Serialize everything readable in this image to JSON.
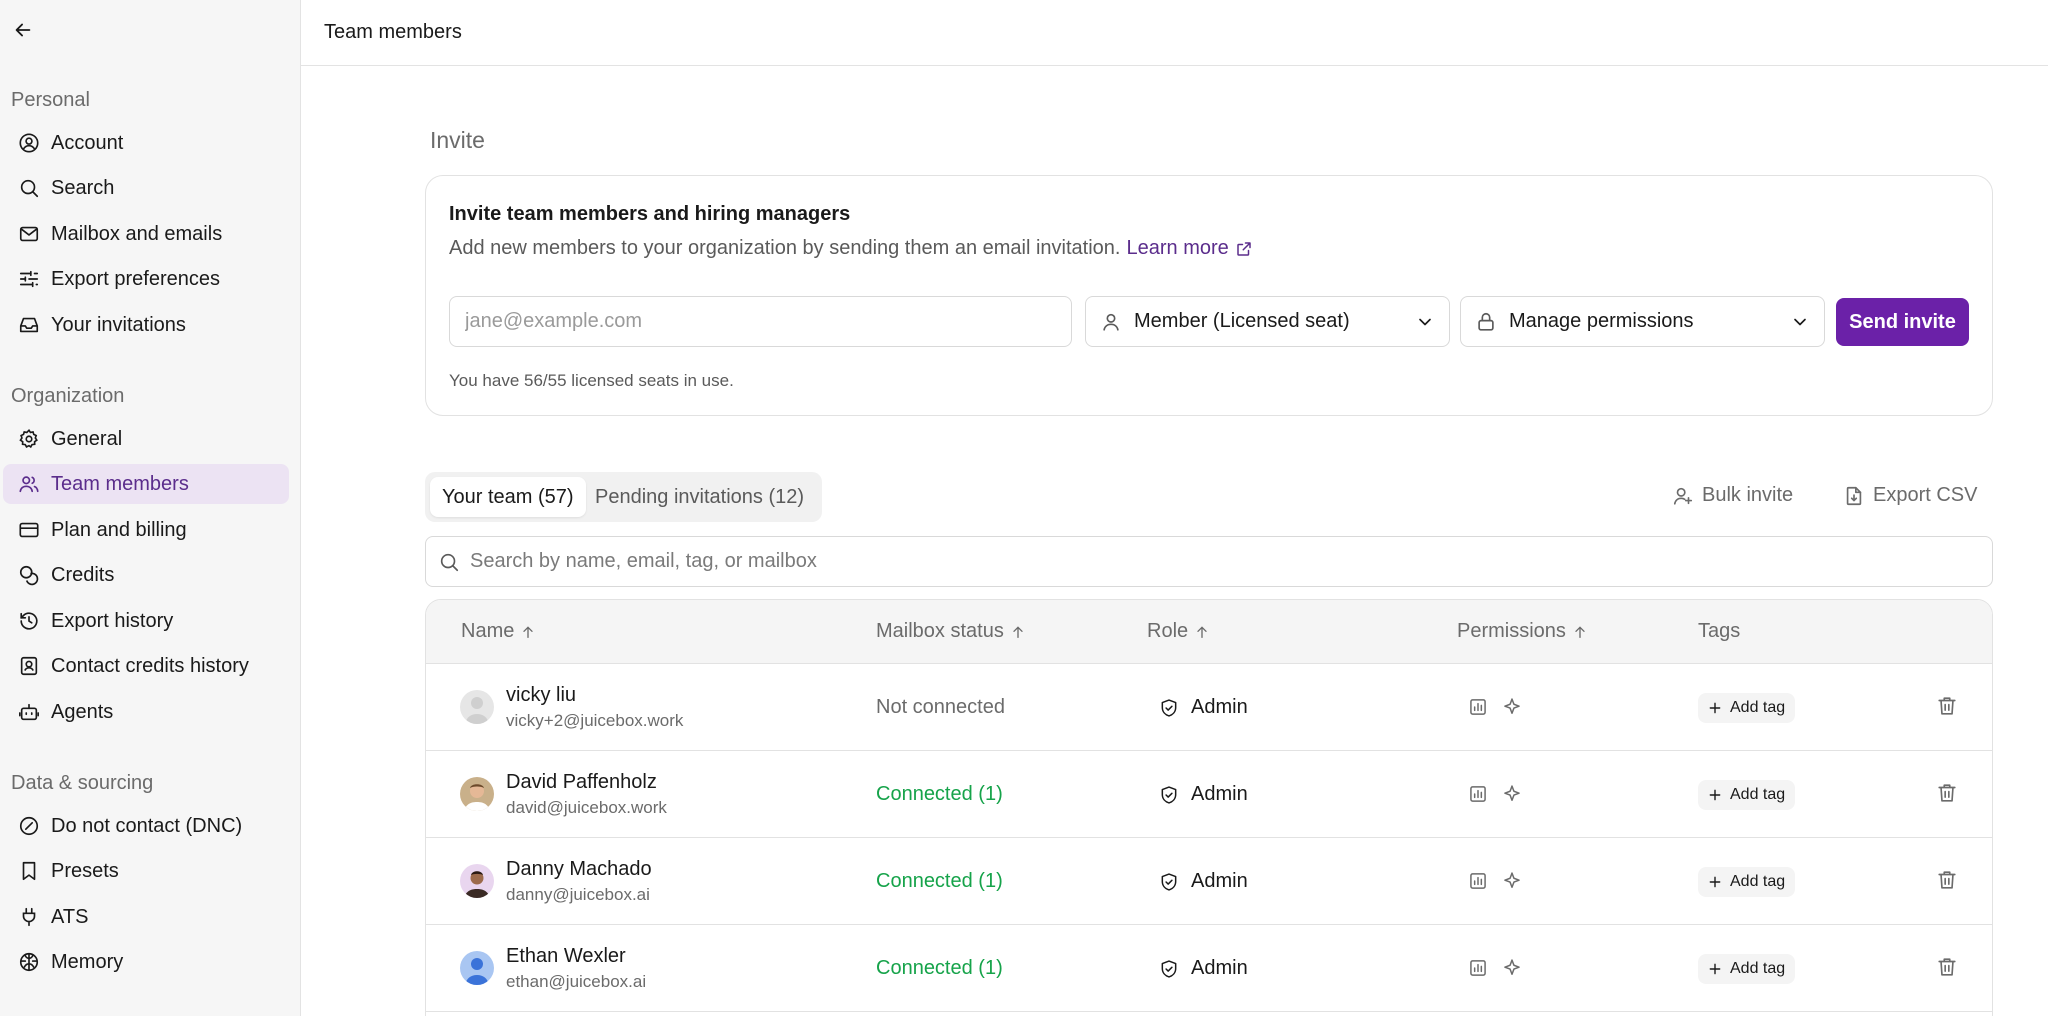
{
  "header": {
    "title": "Team members"
  },
  "sidebar": {
    "sections": [
      {
        "label": "Personal",
        "items": [
          {
            "label": "Account",
            "icon": "user-circle-icon"
          },
          {
            "label": "Search",
            "icon": "search-icon"
          },
          {
            "label": "Mailbox and emails",
            "icon": "mail-icon"
          },
          {
            "label": "Export preferences",
            "icon": "sliders-icon"
          },
          {
            "label": "Your invitations",
            "icon": "inbox-icon"
          }
        ]
      },
      {
        "label": "Organization",
        "items": [
          {
            "label": "General",
            "icon": "gear-icon"
          },
          {
            "label": "Team members",
            "icon": "users-icon",
            "active": true
          },
          {
            "label": "Plan and billing",
            "icon": "credit-card-icon"
          },
          {
            "label": "Credits",
            "icon": "coins-icon"
          },
          {
            "label": "Export history",
            "icon": "history-icon"
          },
          {
            "label": "Contact credits history",
            "icon": "contact-book-icon"
          },
          {
            "label": "Agents",
            "icon": "robot-icon"
          }
        ]
      },
      {
        "label": "Data & sourcing",
        "items": [
          {
            "label": "Do not contact (DNC)",
            "icon": "block-icon"
          },
          {
            "label": "Presets",
            "icon": "bookmark-icon"
          },
          {
            "label": "ATS",
            "icon": "plug-icon"
          },
          {
            "label": "Memory",
            "icon": "brain-icon"
          }
        ]
      }
    ]
  },
  "invite": {
    "heading": "Invite",
    "card_title": "Invite team members and hiring managers",
    "description": "Add new members to your organization by sending them an email invitation.",
    "learn_more": "Learn more",
    "email_placeholder": "jane@example.com",
    "email_value": "",
    "role_select": "Member (Licensed seat)",
    "permissions_select": "Manage permissions",
    "send_label": "Send invite",
    "seats_text": "You have 56/55 licensed seats in use."
  },
  "tabs": {
    "your_team": "Your team (57)",
    "pending": "Pending invitations (12)"
  },
  "actions": {
    "bulk_invite": "Bulk invite",
    "export_csv": "Export CSV"
  },
  "search": {
    "placeholder": "Search by name, email, tag, or mailbox"
  },
  "table": {
    "columns": {
      "name": "Name",
      "mailbox": "Mailbox status",
      "role": "Role",
      "permissions": "Permissions",
      "tags": "Tags"
    },
    "add_tag_label": "Add tag",
    "status_colors": {
      "connected": "#16a34a",
      "not_connected": "#6b6b6b"
    },
    "rows": [
      {
        "name": "vicky liu",
        "email": "vicky+2@juicebox.work",
        "mailbox": "Not connected",
        "connected": false,
        "role": "Admin"
      },
      {
        "name": "David Paffenholz",
        "email": "david@juicebox.work",
        "mailbox": "Connected (1)",
        "connected": true,
        "role": "Admin"
      },
      {
        "name": "Danny Machado",
        "email": "danny@juicebox.ai",
        "mailbox": "Connected (1)",
        "connected": true,
        "role": "Admin"
      },
      {
        "name": "Ethan Wexler",
        "email": "ethan@juicebox.ai",
        "mailbox": "Connected (1)",
        "connected": true,
        "role": "Admin"
      }
    ]
  },
  "theme": {
    "accent": "#6b21a8",
    "active_nav_bg": "#ece3f3",
    "active_nav_text": "#5b2d8c"
  }
}
